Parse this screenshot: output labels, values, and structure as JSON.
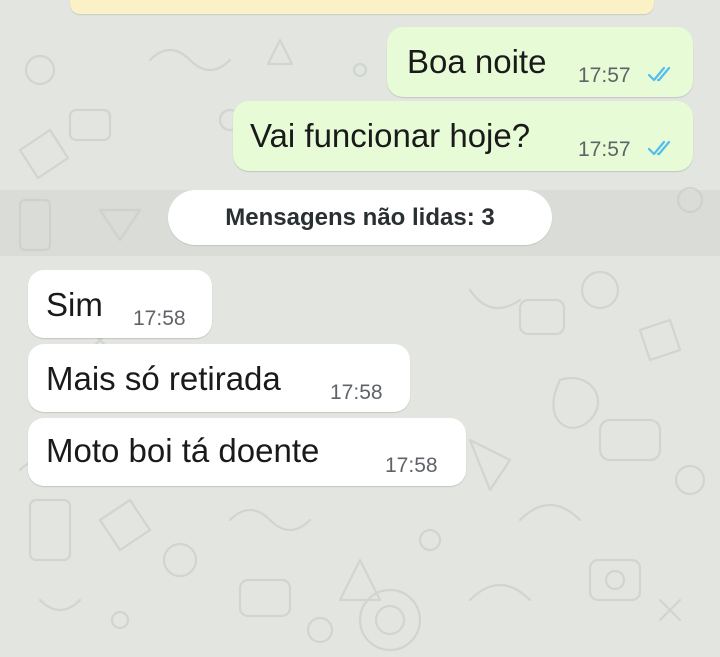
{
  "colors": {
    "background": "#e2e5e0",
    "outgoing_bubble": "#e6fbd6",
    "incoming_bubble": "#ffffff",
    "read_ticks": "#53bdeb",
    "time_text": "#5f6368"
  },
  "messages": [
    {
      "direction": "outgoing",
      "text": "Boa noite",
      "time": "17:57",
      "status": "read"
    },
    {
      "direction": "outgoing",
      "text": "Vai funcionar hoje?",
      "time": "17:57",
      "status": "read"
    },
    {
      "direction": "incoming",
      "text": "Sim",
      "time": "17:58"
    },
    {
      "direction": "incoming",
      "text": "Mais só retirada",
      "time": "17:58"
    },
    {
      "direction": "incoming",
      "text": "Moto boi tá doente",
      "time": "17:58"
    }
  ],
  "unread_divider": {
    "label": "Mensagens não lidas: 3"
  }
}
